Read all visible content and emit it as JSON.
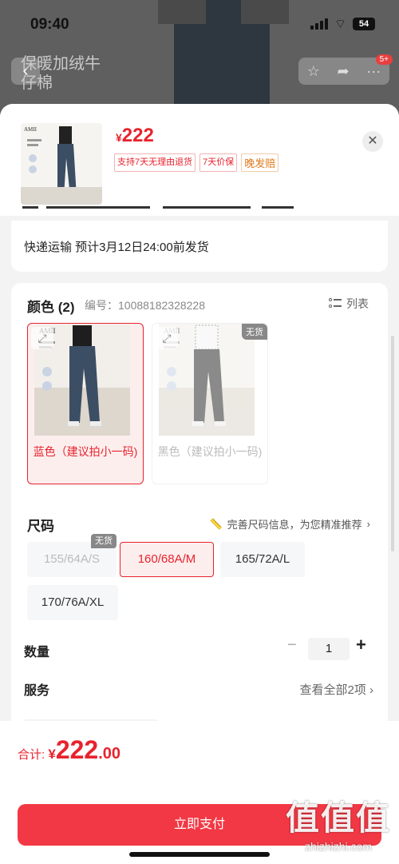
{
  "status_bar": {
    "time": "09:40",
    "battery": "54"
  },
  "background_page": {
    "title": "保暖加绒牛仔棉",
    "badge": "5+"
  },
  "product": {
    "currency": "¥",
    "price": "222",
    "tags": [
      "支持7天无理由退货",
      "7天价保",
      "晚发赔"
    ]
  },
  "shipping": {
    "text": "快递运输 预计3月12日24:00前发货"
  },
  "color": {
    "title": "颜色 (2)",
    "code_label": "编号：10088182328228",
    "view_toggle": "列表",
    "options": [
      {
        "label": "蓝色（建议拍小一码)",
        "selected": true,
        "sold_out": false
      },
      {
        "label": "黑色（建议拍小一码)",
        "selected": false,
        "sold_out": true,
        "sold_out_label": "无货"
      }
    ]
  },
  "size": {
    "title": "尺码",
    "hint": "完善尺码信息，为您精准推荐",
    "options": [
      {
        "label": "155/64A/S",
        "state": "disabled",
        "sold_out_label": "无货"
      },
      {
        "label": "160/68A/M",
        "state": "selected"
      },
      {
        "label": "165/72A/L",
        "state": "normal"
      },
      {
        "label": "170/76A/XL",
        "state": "normal"
      }
    ]
  },
  "quantity": {
    "label": "数量",
    "value": "1"
  },
  "service": {
    "label": "服务",
    "link": "查看全部2项"
  },
  "footer": {
    "total_label": "合计:",
    "currency": "¥",
    "total_int": "222",
    "total_dec": ".00",
    "pay_button": "立即支付"
  },
  "watermark": {
    "main": "值值值",
    "sub": "zhizhizhi.com"
  },
  "colors": {
    "accent": "#e8232d",
    "pay_button": "#f23844",
    "tag_orange": "#e07a1b"
  },
  "icons": [
    "back-icon",
    "star-icon",
    "share-icon",
    "more-icon",
    "close-icon",
    "expand-icon",
    "list-view-icon",
    "ruler-icon",
    "chevron-right-icon",
    "minus-icon",
    "plus-icon"
  ]
}
